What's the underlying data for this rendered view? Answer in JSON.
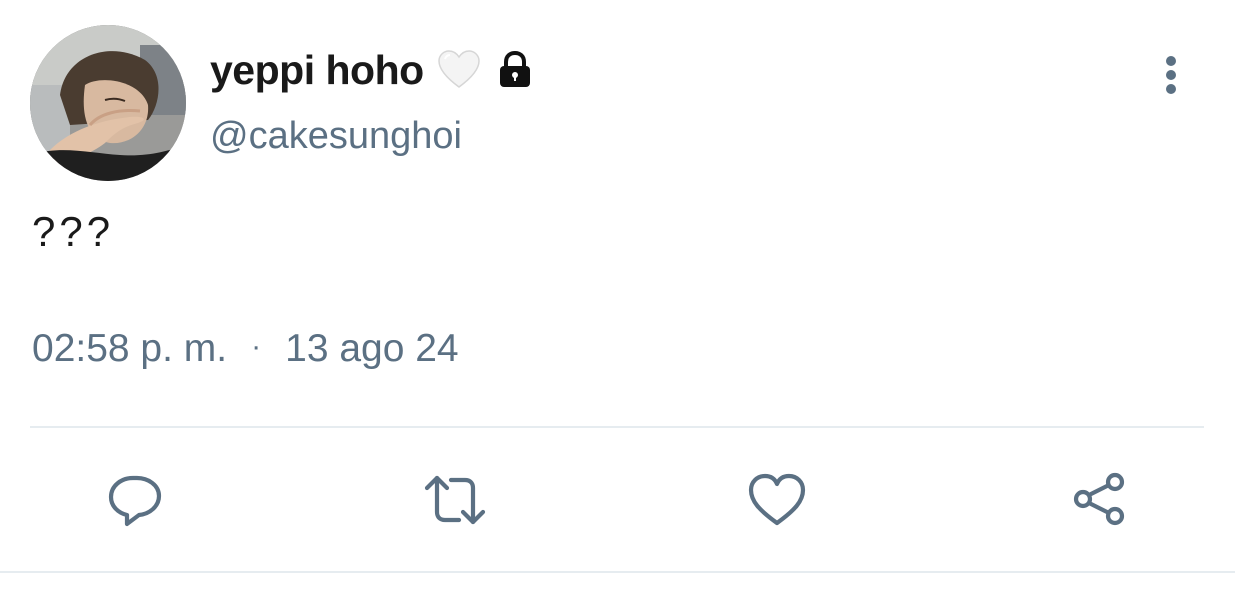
{
  "tweet": {
    "author": {
      "display_name": "yeppi hoho",
      "handle": "@cakesunghoi",
      "badges": [
        "white-heart-emoji",
        "lock-icon"
      ]
    },
    "text": "???",
    "time": "02:58 p. m.",
    "separator": "·",
    "date": "13 ago 24"
  },
  "actions": [
    {
      "icon": "reply-icon"
    },
    {
      "icon": "retweet-icon"
    },
    {
      "icon": "like-icon"
    },
    {
      "icon": "share-icon"
    }
  ],
  "colors": {
    "text_primary": "#1a1a1a",
    "text_secondary": "#5b7083",
    "icon": "#5b7083",
    "divider": "#e6ecf0",
    "background": "#ffffff"
  }
}
